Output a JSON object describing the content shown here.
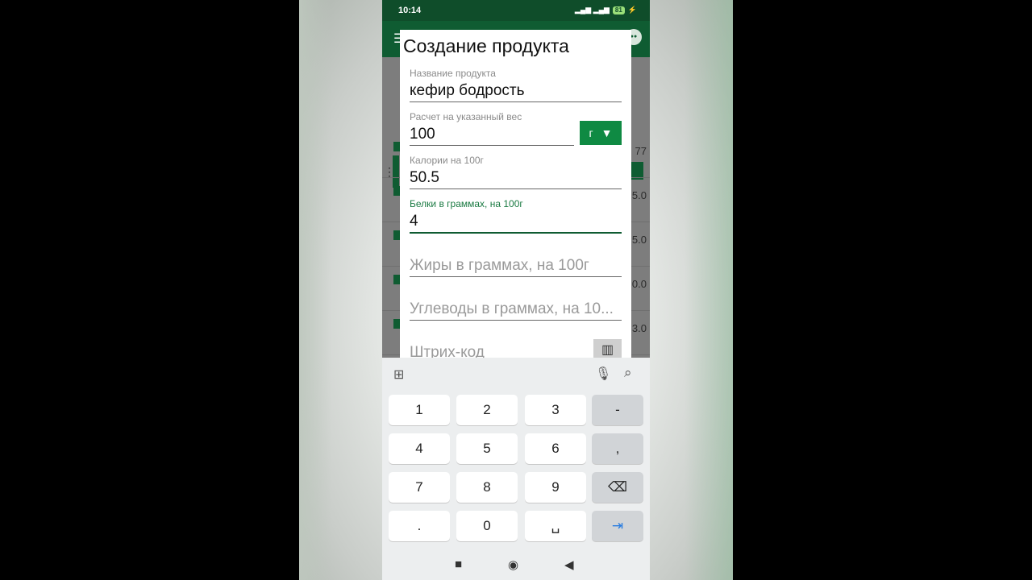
{
  "status": {
    "time": "10:14",
    "battery": "81"
  },
  "dialog": {
    "title": "Создание продукта",
    "fields": {
      "name": {
        "label": "Название продукта",
        "value": "кефир бодрость"
      },
      "weight": {
        "label": "Расчет на указанный вес",
        "value": "100",
        "unit": "г"
      },
      "calories": {
        "label": "Калории на 100г",
        "value": "50.5"
      },
      "protein": {
        "label": "Белки в граммах, на 100г",
        "value": "4"
      },
      "fat": {
        "placeholder": "Жиры в граммах, на 100г"
      },
      "carbs": {
        "placeholder": "Углеводы в граммах, на 10..."
      },
      "barcode": {
        "placeholder": "Штрих-код"
      }
    }
  },
  "background_values": [
    "77",
    "5.0",
    "5.0",
    "0.0",
    "3.0"
  ],
  "keyboard": {
    "rows": [
      [
        "1",
        "2",
        "3",
        "-"
      ],
      [
        "4",
        "5",
        "6",
        ","
      ],
      [
        "7",
        "8",
        "9",
        "⌫"
      ],
      [
        ".",
        "0",
        "␣",
        "⇥"
      ]
    ]
  },
  "colors": {
    "primary": "#0f5c32",
    "accent": "#0f8a43",
    "active_label": "#1a7a42",
    "tab_key": "#2a7de0"
  },
  "icons": [
    "menu-icon",
    "chat-icon",
    "grid-icon",
    "mic-icon",
    "search-icon",
    "dropdown-arrow-icon",
    "barcode-icon",
    "backspace-icon",
    "tab-icon",
    "nav-square-icon",
    "nav-circle-icon",
    "nav-back-icon"
  ]
}
